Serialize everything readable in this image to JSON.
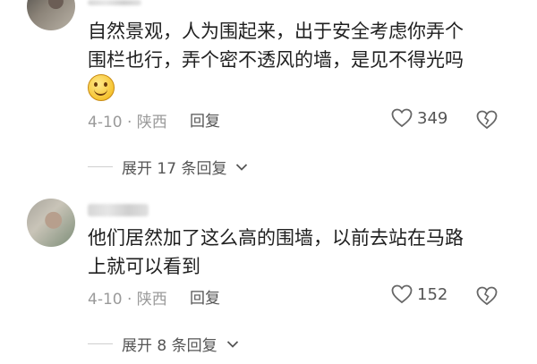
{
  "comments": [
    {
      "text_lines": [
        "自然景观，人为围起来，出于安全考虑你弄个",
        "围栏也行，弄个密不透风的墙，是见不得光吗"
      ],
      "date_location": "4-10 · 陕西",
      "reply_label": "回复",
      "like_count": "349",
      "expand_label": "展开 17 条回复"
    },
    {
      "text_lines": [
        "他们居然加了这么高的围墙，以前去站在马路",
        "上就可以看到"
      ],
      "date_location": "4-10 · 陕西",
      "reply_label": "回复",
      "like_count": "152",
      "expand_label": "展开 8 条回复"
    }
  ]
}
